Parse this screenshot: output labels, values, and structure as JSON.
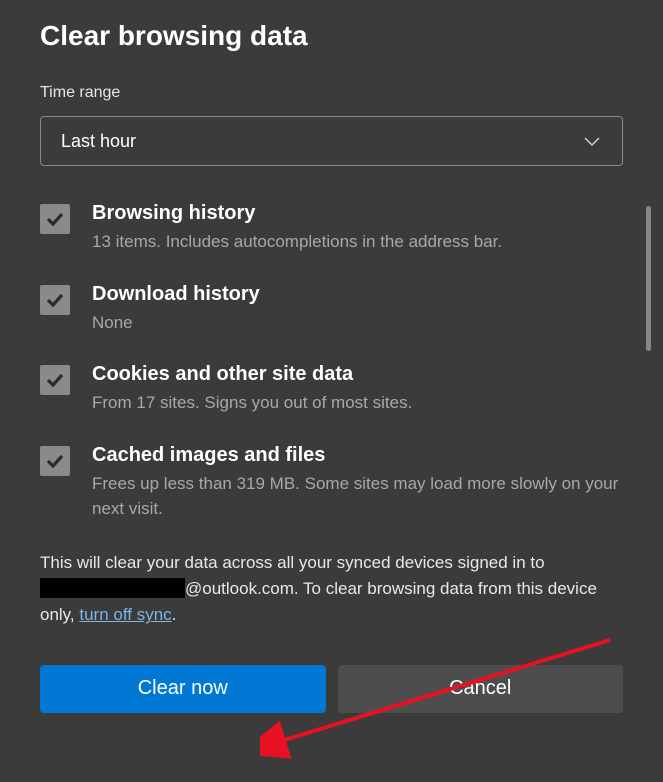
{
  "title": "Clear browsing data",
  "time_range": {
    "label": "Time range",
    "selected": "Last hour"
  },
  "options": [
    {
      "title": "Browsing history",
      "desc": "13 items. Includes autocompletions in the address bar.",
      "checked": true
    },
    {
      "title": "Download history",
      "desc": "None",
      "checked": true
    },
    {
      "title": "Cookies and other site data",
      "desc": "From 17 sites. Signs you out of most sites.",
      "checked": true
    },
    {
      "title": "Cached images and files",
      "desc": "Frees up less than 319 MB. Some sites may load more slowly on your next visit.",
      "checked": true
    }
  ],
  "notice": {
    "prefix": "This will clear your data across all your synced devices signed in to ",
    "email_domain": "@outlook.com. To clear browsing data from this device only, ",
    "link": "turn off sync",
    "suffix": "."
  },
  "buttons": {
    "primary": "Clear now",
    "secondary": "Cancel"
  }
}
